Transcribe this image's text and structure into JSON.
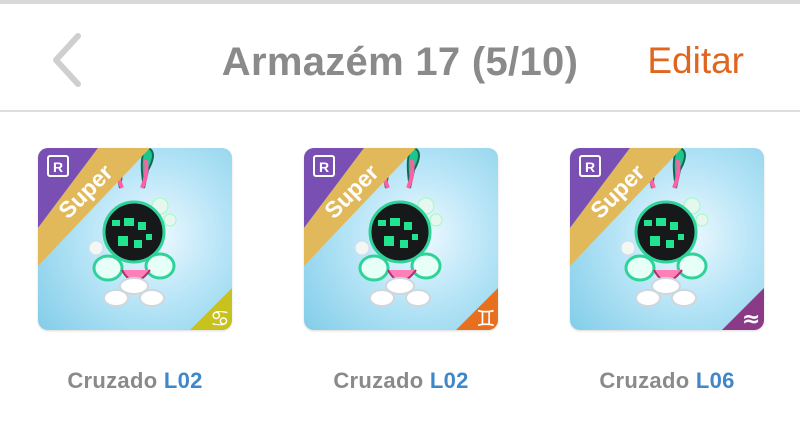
{
  "header": {
    "back_icon": "chevron-left-icon",
    "title": "Armazém 17 (5/10)",
    "edit_label": "Editar"
  },
  "colors": {
    "accent": "#e0651e",
    "title_gray": "#8a8a8a",
    "level_blue": "#3f87c8",
    "rarity_purple": "#7a4fb3",
    "ribbon_gold": "#e2b95a"
  },
  "items": [
    {
      "ribbon": "Super",
      "rarity_icon": "R",
      "name": "Cruzado",
      "level": "L02",
      "element_icon": "cancer-icon",
      "element_glyph": "♋",
      "badge_color": "#c8c21f"
    },
    {
      "ribbon": "Super",
      "rarity_icon": "R",
      "name": "Cruzado",
      "level": "L02",
      "element_icon": "gemini-icon",
      "element_glyph": "♊",
      "badge_color": "#e7701f"
    },
    {
      "ribbon": "Super",
      "rarity_icon": "R",
      "name": "Cruzado",
      "level": "L06",
      "element_icon": "wave-icon",
      "element_glyph": "≈",
      "badge_color": "#8a3a86"
    }
  ]
}
